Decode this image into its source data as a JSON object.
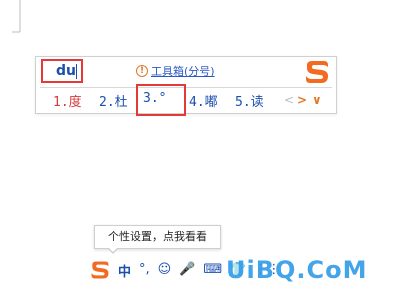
{
  "ime": {
    "composition": "du",
    "toolbox_label": "工具箱(分号)",
    "info_icon": "!",
    "candidates": [
      {
        "index": "1.",
        "text": "度",
        "color": "#d23b3b"
      },
      {
        "index": "2.",
        "text": "杜",
        "color": "#1a4fb0"
      },
      {
        "index": "3.",
        "text": "°",
        "color": "#1a4fb0"
      },
      {
        "index": "4.",
        "text": "嘟",
        "color": "#1a4fb0"
      },
      {
        "index": "5.",
        "text": "读",
        "color": "#1a4fb0"
      }
    ],
    "pager": {
      "prev": "<",
      "next": ">",
      "expand": "∨"
    }
  },
  "tooltip": {
    "text": "个性设置，点我看看"
  },
  "statusbar": {
    "lang": "中",
    "punctuation": "°,",
    "emoji": "☺",
    "mic": "🎤",
    "keyboard": "⌨",
    "skin": "👕",
    "toolbox": "⋮⋮"
  },
  "watermark": {
    "text": "UiBQ.CoM",
    "color": "#2f9be8"
  },
  "colors": {
    "brand": "#f26b21",
    "highlight": "#e53935",
    "blue": "#1a4fb0"
  }
}
